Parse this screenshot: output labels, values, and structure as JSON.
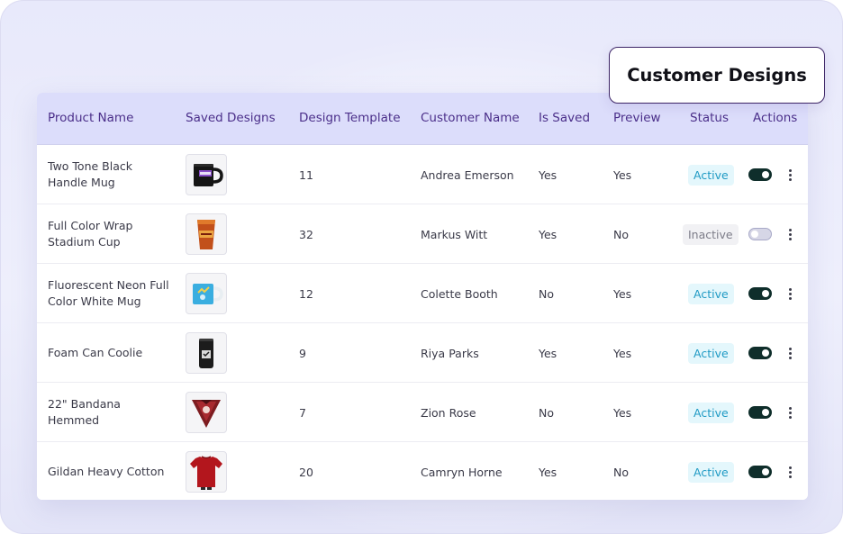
{
  "page": {
    "title": "Customer Designs"
  },
  "colors": {
    "header_bg": "#dcddfb",
    "header_text": "#4b2f8a",
    "active_text": "#1f9ac4",
    "active_bg": "#e4f7fc",
    "inactive_text": "#7c7c88",
    "inactive_bg": "#f1f1f4",
    "toggle_on": "#0f2e2b",
    "title_border": "#3c2466"
  },
  "table": {
    "columns": [
      "Product Name",
      "Saved Designs",
      "Design Template",
      "Customer Name",
      "Is Saved",
      "Preview",
      "Status",
      "Actions"
    ],
    "rows": [
      {
        "product_name": "Two Tone Black Handle Mug",
        "thumbnail_icon": "black-mug-icon",
        "design_template": "11",
        "customer_name": "Andrea Emerson",
        "is_saved": "Yes",
        "preview": "Yes",
        "status": "Active",
        "enabled": true
      },
      {
        "product_name": "Full Color Wrap Stadium Cup",
        "thumbnail_icon": "stadium-cup-icon",
        "design_template": "32",
        "customer_name": "Markus Witt",
        "is_saved": "Yes",
        "preview": "No",
        "status": "Inactive",
        "enabled": false
      },
      {
        "product_name": "Fluorescent Neon Full Color White Mug",
        "thumbnail_icon": "blue-mug-icon",
        "design_template": "12",
        "customer_name": "Colette Booth",
        "is_saved": "No",
        "preview": "Yes",
        "status": "Active",
        "enabled": true
      },
      {
        "product_name": "Foam Can Coolie",
        "thumbnail_icon": "can-coolie-icon",
        "design_template": "9",
        "customer_name": "Riya Parks",
        "is_saved": "Yes",
        "preview": "Yes",
        "status": "Active",
        "enabled": true
      },
      {
        "product_name": "22\" Bandana Hemmed",
        "thumbnail_icon": "bandana-icon",
        "design_template": "7",
        "customer_name": "Zion Rose",
        "is_saved": "No",
        "preview": "Yes",
        "status": "Active",
        "enabled": true
      },
      {
        "product_name": "Gildan Heavy Cotton",
        "thumbnail_icon": "red-tshirt-icon",
        "design_template": "20",
        "customer_name": "Camryn Horne",
        "is_saved": "Yes",
        "preview": "No",
        "status": "Active",
        "enabled": true
      }
    ]
  }
}
